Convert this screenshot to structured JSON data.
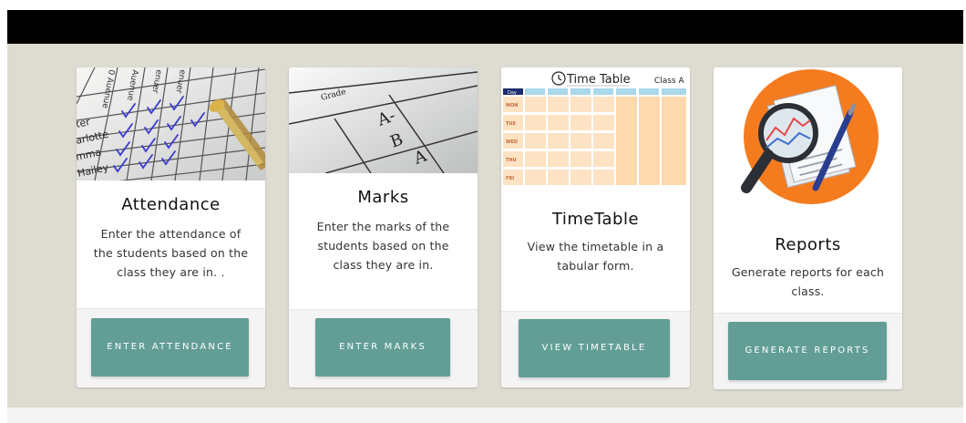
{
  "cards": [
    {
      "title": "Attendance",
      "description": "Enter the attendance of the students based on the class they are in. .",
      "button": "ENTER ATTENDANCE",
      "image_text": {
        "names": [
          "ter",
          "arlotte",
          "mma",
          "Hailey"
        ],
        "months": [
          "0 Auenue",
          "Auenue",
          "enuer",
          "enuer"
        ]
      }
    },
    {
      "title": "Marks",
      "description": "Enter the marks of the students based on the class they are in.",
      "button": "ENTER MARKS",
      "image_text": {
        "header": "Grade",
        "grades": [
          "A-",
          "B",
          "A"
        ]
      }
    },
    {
      "title": "TimeTable",
      "description": "View the timetable in a tabular form.",
      "button": "VIEW TIMETABLE",
      "image_text": {
        "header": "Time Table",
        "class": "Class A",
        "day_label": "Day",
        "days": [
          "MON",
          "TUE",
          "WED",
          "THU",
          "FRI"
        ]
      }
    },
    {
      "title": "Reports",
      "description": "Generate reports for each class.",
      "button": "GENERATE REPORTS"
    }
  ],
  "colors": {
    "topbar": "#000000",
    "background": "#dedcd1",
    "button": "#629e96",
    "report_circle": "#f47c1f"
  },
  "icons": [
    "attendance-photo",
    "grade-sheet-photo",
    "timetable-illustration",
    "magnifier-report-icon"
  ]
}
